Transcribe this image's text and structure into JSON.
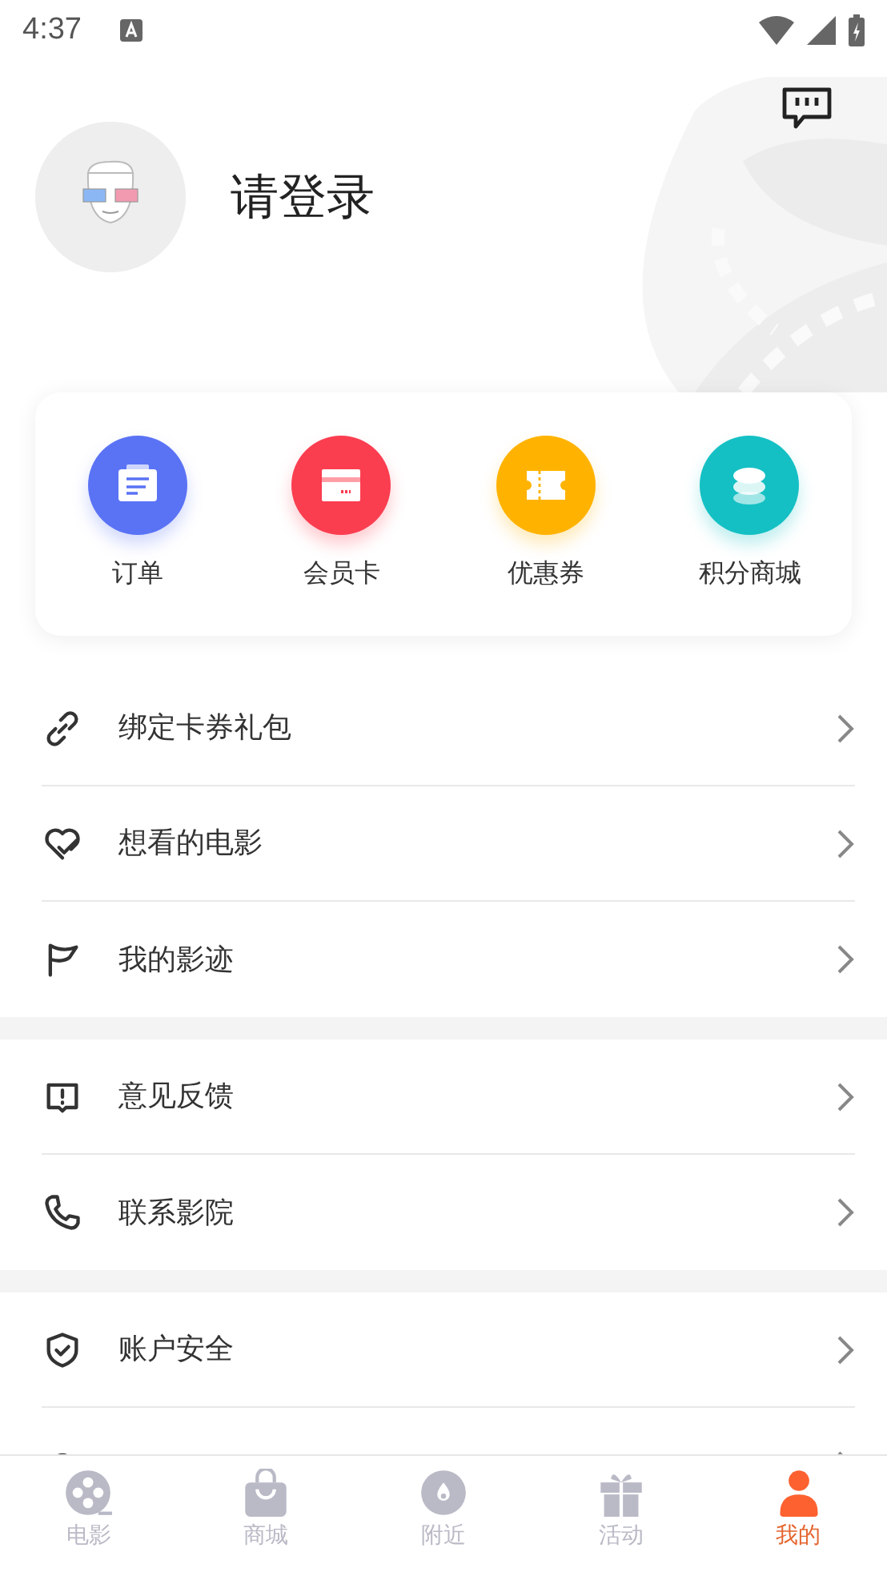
{
  "status_bar": {
    "time": "4:37"
  },
  "profile": {
    "name": "请登录"
  },
  "shortcuts": [
    {
      "label": "订单",
      "color": "#5a73f5"
    },
    {
      "label": "会员卡",
      "color": "#fb3d50"
    },
    {
      "label": "优惠券",
      "color": "#ffb300"
    },
    {
      "label": "积分商城",
      "color": "#14c0c4"
    }
  ],
  "menu_groups": [
    [
      {
        "label": "绑定卡券礼包"
      },
      {
        "label": "想看的电影"
      },
      {
        "label": "我的影迹"
      }
    ],
    [
      {
        "label": "意见反馈"
      },
      {
        "label": "联系影院"
      }
    ],
    [
      {
        "kind": "full",
        "label": "账户安全"
      },
      {
        "kind": "cut_off"
      }
    ]
  ],
  "tabs": [
    {
      "label": "电影",
      "selected": false
    },
    {
      "label": "商城",
      "selected": false
    },
    {
      "label": "附近",
      "selected": false
    },
    {
      "label": "活动",
      "selected": false
    },
    {
      "label": "我的",
      "selected": true
    }
  ]
}
